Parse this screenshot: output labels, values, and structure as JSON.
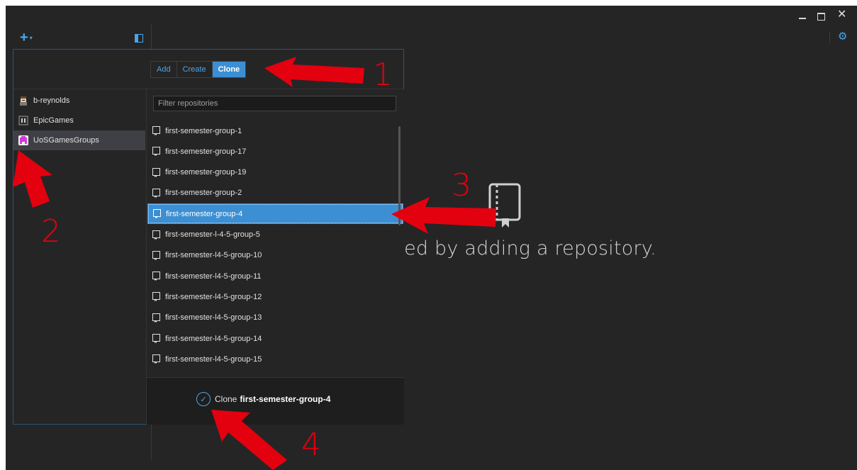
{
  "window": {
    "minimize_icon": "minimize-icon",
    "maximize_icon": "maximize-icon",
    "close_glyph": "✕",
    "settings_glyph": "⚙"
  },
  "toolbar": {
    "add_glyph": "+",
    "caret_glyph": "▾"
  },
  "popup": {
    "tabs": [
      "Add",
      "Create",
      "Clone"
    ],
    "active_tab": "Clone",
    "owners": [
      {
        "name": "b-reynolds",
        "avatar_color": "#c8a27a"
      },
      {
        "name": "EpicGames",
        "avatar_color": "#6b6b6b"
      },
      {
        "name": "UoSGamesGroups",
        "avatar_color": "#d23ad6",
        "selected": true
      }
    ],
    "filter_placeholder": "Filter repositories",
    "repositories": [
      "first-semester-group-1",
      "first-semester-group-17",
      "first-semester-group-19",
      "first-semester-group-2",
      "first-semester-group-4",
      "first-semester-l-4-5-group-5",
      "first-semester-l4-5-group-10",
      "first-semester-l4-5-group-11",
      "first-semester-l4-5-group-12",
      "first-semester-l4-5-group-13",
      "first-semester-l4-5-group-14",
      "first-semester-l4-5-group-15"
    ],
    "selected_repository": "first-semester-group-4",
    "clone_label": "Clone",
    "clone_target": "first-semester-group-4"
  },
  "empty_state": {
    "text": "rted by adding a repository."
  },
  "annotations": {
    "labels": [
      "1",
      "2",
      "3",
      "4"
    ],
    "color": "#e3000f"
  },
  "colors": {
    "accent": "#4aa6e8",
    "selected": "#3c8fd3",
    "background": "#252526"
  }
}
